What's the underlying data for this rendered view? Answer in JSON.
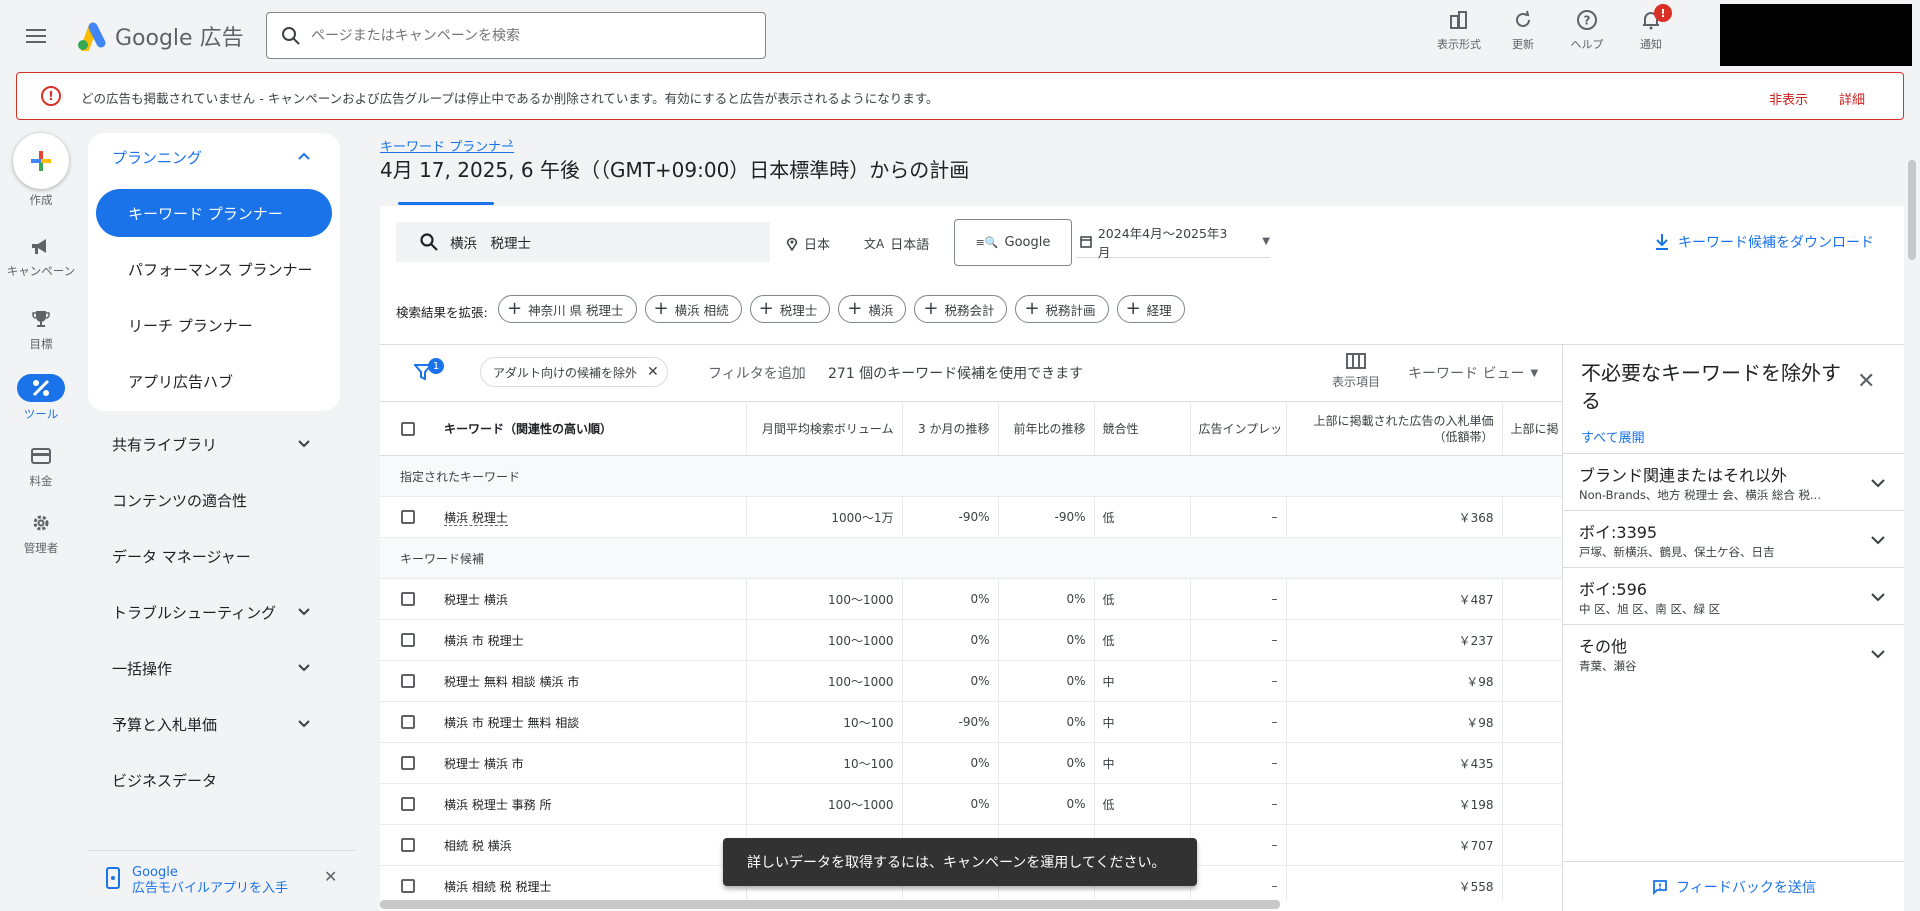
{
  "app": {
    "logo_text": "Google 広告"
  },
  "search": {
    "placeholder": "ページまたはキャンペーンを検索"
  },
  "top_actions": [
    {
      "label": "表示形式",
      "icon": "appearance-icon"
    },
    {
      "label": "更新",
      "icon": "refresh-icon"
    },
    {
      "label": "ヘルプ",
      "icon": "help-icon"
    },
    {
      "label": "通知",
      "icon": "bell-icon",
      "badge": "!"
    }
  ],
  "alert": {
    "text": "どの広告も掲載されていません - キャンペーンおよび広告グループは停止中であるか削除されています。有効にすると広告が表示されるようになります。",
    "dismiss": "非表示",
    "details": "詳細"
  },
  "rail": {
    "create": "作成",
    "campaign": "キャンペーン",
    "goals": "目標",
    "tools": "ツール",
    "billing": "料金",
    "admin": "管理者"
  },
  "nav": {
    "planning": "プランニング",
    "keyword_planner": "キーワード プランナー",
    "performance_planner": "パフォーマンス プランナー",
    "reach_planner": "リーチ プランナー",
    "app_hub": "アプリ広告ハブ",
    "shared_library": "共有ライブラリ",
    "content_suitability": "コンテンツの適合性",
    "data_manager": "データ マネージャー",
    "troubleshooting": "トラブルシューティング",
    "bulk_actions": "一括操作",
    "budgets_bids": "予算と入札単価",
    "business_data": "ビジネスデータ"
  },
  "promo": {
    "line1": "Google",
    "line2": "広告モバイルアプリを入手"
  },
  "header": {
    "breadcrumb": "キーワード プランナー",
    "title": "4月 17, 2025, 6 午後（（GMT+09:00）日本標準時）からの計画"
  },
  "controls": {
    "keyword_query": "横浜　税理士",
    "location": "日本",
    "language": "日本語",
    "network": "Google",
    "date_range": "2024年4月～2025年3月",
    "download": "キーワード候補をダウンロード"
  },
  "expand": {
    "label": "検索結果を拡張:",
    "chips": [
      "神奈川 県 税理士",
      "横浜 相続",
      "税理士",
      "横浜",
      "税務会計",
      "税務計画",
      "経理"
    ]
  },
  "filter_bar": {
    "filter_count": "1",
    "adult_chip": "アダルト向けの候補を除外",
    "add_filter": "フィルタを追加",
    "count_text": "271 個のキーワード候補を使用できます",
    "columns": "表示項目",
    "view": "キーワード ビュー"
  },
  "table": {
    "headers": [
      "キーワード（関連性の高い順）",
      "月間平均検索ボリューム",
      "3 か月の推移",
      "前年比の推移",
      "競合性",
      "広告インプレッ",
      "上部に掲載された広告の入札単価（低額帯）",
      "上部に掲"
    ],
    "group_specified": "指定されたキーワード",
    "group_candidates": "キーワード候補",
    "specified_rows": [
      [
        "横浜 税理士",
        "1000～1万",
        "-90%",
        "-90%",
        "低",
        "–",
        "￥368"
      ]
    ],
    "candidate_rows": [
      [
        "税理士 横浜",
        "100～1000",
        "0%",
        "0%",
        "低",
        "–",
        "￥487"
      ],
      [
        "横浜 市 税理士",
        "100～1000",
        "0%",
        "0%",
        "低",
        "–",
        "￥237"
      ],
      [
        "税理士 無料 相談 横浜 市",
        "100～1000",
        "0%",
        "0%",
        "中",
        "–",
        "￥98"
      ],
      [
        "横浜 市 税理士 無料 相談",
        "10～100",
        "-90%",
        "0%",
        "中",
        "–",
        "￥98"
      ],
      [
        "税理士 横浜 市",
        "10～100",
        "0%",
        "0%",
        "中",
        "–",
        "￥435"
      ],
      [
        "横浜 税理士 事務 所",
        "100～1000",
        "0%",
        "0%",
        "低",
        "–",
        "￥198"
      ],
      [
        "相続 税 横浜",
        "",
        "",
        "",
        "",
        "–",
        "￥707"
      ],
      [
        "横浜 相続 税 税理士",
        "",
        "",
        "",
        "",
        "–",
        "￥558"
      ]
    ]
  },
  "right_panel": {
    "title": "不必要なキーワードを除外する",
    "expand_all": "すべて展開",
    "groups": [
      {
        "title": "ブランド関連またはそれ以外",
        "sub": "Non-Brands、地方 税理士 会、横浜 総合 税..."
      },
      {
        "title": "ボイ:3395",
        "sub": "戸塚、新横浜、鶴見、保土ケ谷、日吉"
      },
      {
        "title": "ボイ:596",
        "sub": "中 区、旭 区、南 区、緑 区"
      },
      {
        "title": "その他",
        "sub": "青葉、瀬谷"
      }
    ],
    "feedback": "フィードバックを送信"
  },
  "snackbar": {
    "text": "詳しいデータを取得するには、キャンペーンを運用してください。"
  },
  "colors": {
    "accent": "#1a73e8",
    "alert": "#d93025"
  }
}
